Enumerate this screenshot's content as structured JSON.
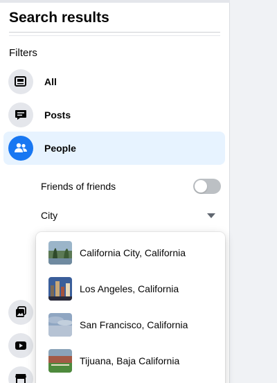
{
  "sidebar": {
    "title": "Search results",
    "filters_label": "Filters",
    "items": [
      {
        "label": "All",
        "icon": "feed-icon"
      },
      {
        "label": "Posts",
        "icon": "posts-icon"
      },
      {
        "label": "People",
        "icon": "people-icon"
      }
    ],
    "friends_of_friends": {
      "label": "Friends of friends",
      "enabled": false
    },
    "city": {
      "label": "City"
    },
    "more_icons": [
      "photos-icon",
      "videos-icon",
      "marketplace-icon"
    ]
  },
  "city_dropdown": {
    "options": [
      {
        "label": "California City, California"
      },
      {
        "label": "Los Angeles, California"
      },
      {
        "label": "San Francisco, California"
      },
      {
        "label": "Tijuana, Baja California"
      }
    ]
  },
  "colors": {
    "accent": "#1877f2",
    "active_bg": "#e7f3ff",
    "icon_bg": "#e4e6eb"
  }
}
